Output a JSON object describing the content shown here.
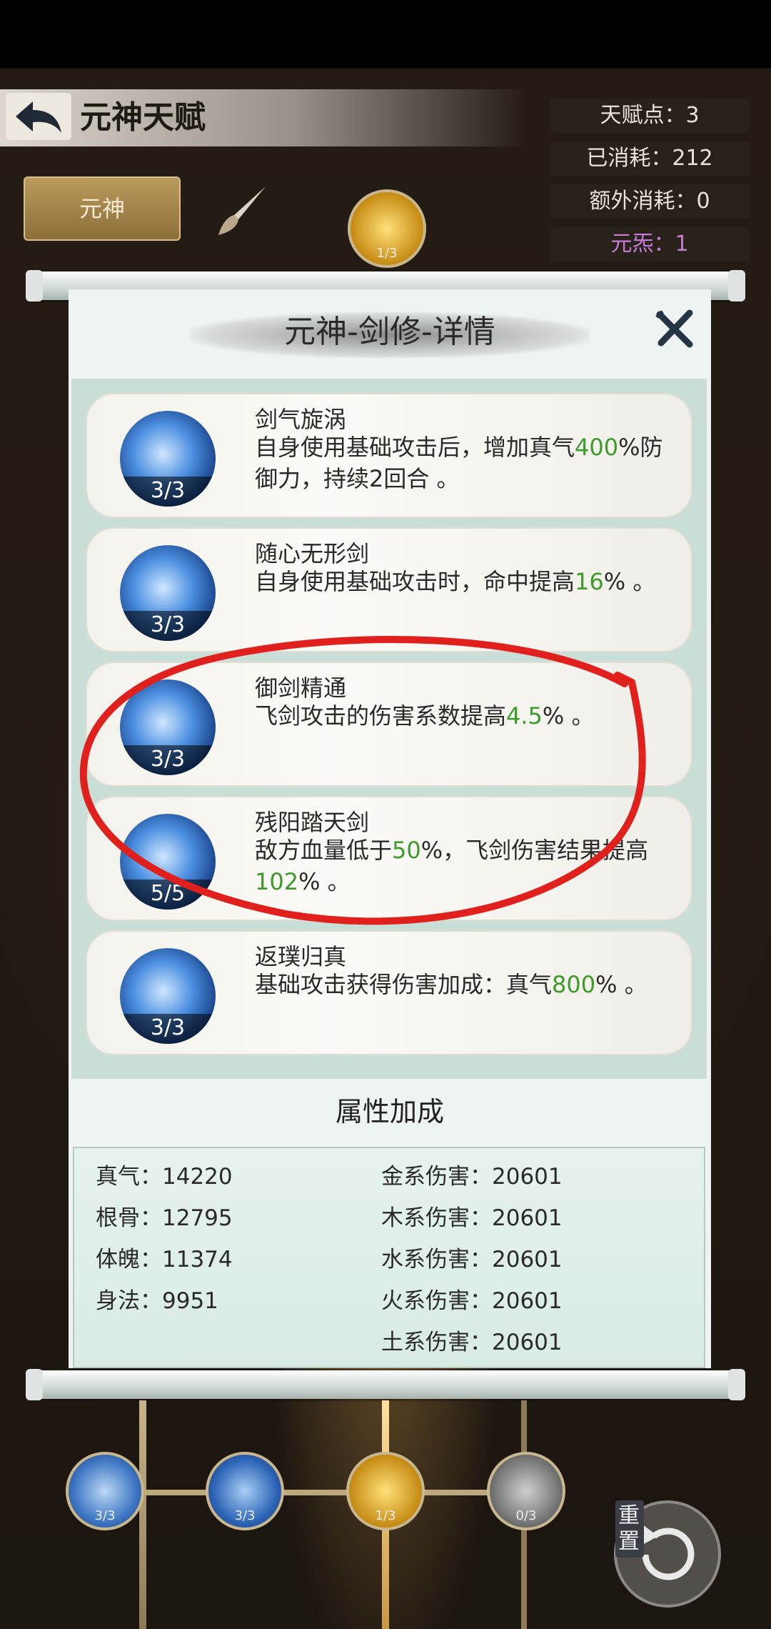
{
  "header": {
    "title": "元神天赋"
  },
  "stats": {
    "talent_points": "天赋点：3",
    "consumed": "已消耗：212",
    "extra_consumed": "额外消耗：0",
    "element": "元炁：1"
  },
  "tab": {
    "label": "元神"
  },
  "top_node": {
    "level": "1/3"
  },
  "panel": {
    "title": "元神-剑修-详情"
  },
  "skills": [
    {
      "name": "剑气旋涡",
      "level": "3/3",
      "desc_a": "自身使用基础攻击后，增加真气",
      "hl": "400",
      "desc_b": "%防御力，持续2回合 。"
    },
    {
      "name": "随心无形剑",
      "level": "3/3",
      "desc_a": "自身使用基础攻击时，命中提高",
      "hl": "16",
      "desc_b": "% 。"
    },
    {
      "name": "御剑精通",
      "level": "3/3",
      "desc_a": "飞剑攻击的伤害系数提高",
      "hl": "4.5",
      "desc_b": "% 。"
    },
    {
      "name": "残阳踏天剑",
      "level": "5/5",
      "desc_a": "敌方血量低于",
      "hl": "50",
      "desc_b": "%，飞剑伤害结果提高",
      "hl2": "102",
      "desc_c": "% 。"
    },
    {
      "name": "返璞归真",
      "level": "3/3",
      "desc_a": "基础攻击获得伤害加成：真气",
      "hl": "800",
      "desc_b": "% 。"
    }
  ],
  "attributes": {
    "title": "属性加成",
    "left": [
      {
        "label": "真气：",
        "value": "14220"
      },
      {
        "label": "根骨：",
        "value": "12795"
      },
      {
        "label": "体魄：",
        "value": "11374"
      },
      {
        "label": "身法：",
        "value": "9951"
      }
    ],
    "right": [
      {
        "label": "金系伤害：",
        "value": "20601"
      },
      {
        "label": "木系伤害：",
        "value": "20601"
      },
      {
        "label": "水系伤害：",
        "value": "20601"
      },
      {
        "label": "火系伤害：",
        "value": "20601"
      },
      {
        "label": "土系伤害：",
        "value": "20601"
      }
    ]
  },
  "bottom_nodes": [
    "3/3",
    "3/3",
    "1/3",
    "0/3"
  ],
  "reset": {
    "label": "重置"
  },
  "colors": {
    "highlight": "#3e9a2a",
    "annotation": "#e0201c",
    "stat_purple": "#c77ad6"
  }
}
